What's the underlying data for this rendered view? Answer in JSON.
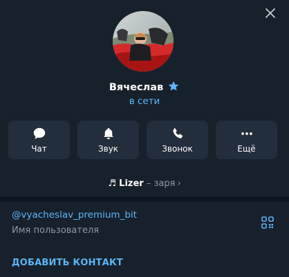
{
  "profile": {
    "name": "Вячеслав",
    "status": "в сети",
    "premium_icon": "star-icon"
  },
  "actions": [
    {
      "label": "Чат",
      "icon": "chat-icon"
    },
    {
      "label": "Звук",
      "icon": "bell-icon"
    },
    {
      "label": "Звонок",
      "icon": "phone-icon"
    },
    {
      "label": "Ещё",
      "icon": "more-dots-icon"
    }
  ],
  "music": {
    "note": "♬",
    "title": "Lizer",
    "artist": "– заря",
    "chevron": "›"
  },
  "info": {
    "username": "@vyacheslav_premium_bit",
    "username_label": "Имя пользователя",
    "add_contact": "ДОБАВИТЬ КОНТАКТ"
  },
  "colors": {
    "background": "#17212b",
    "button_bg": "#232e3c",
    "accent": "#5eb5f7",
    "muted": "#8a97a4",
    "separator": "#0e1621"
  }
}
